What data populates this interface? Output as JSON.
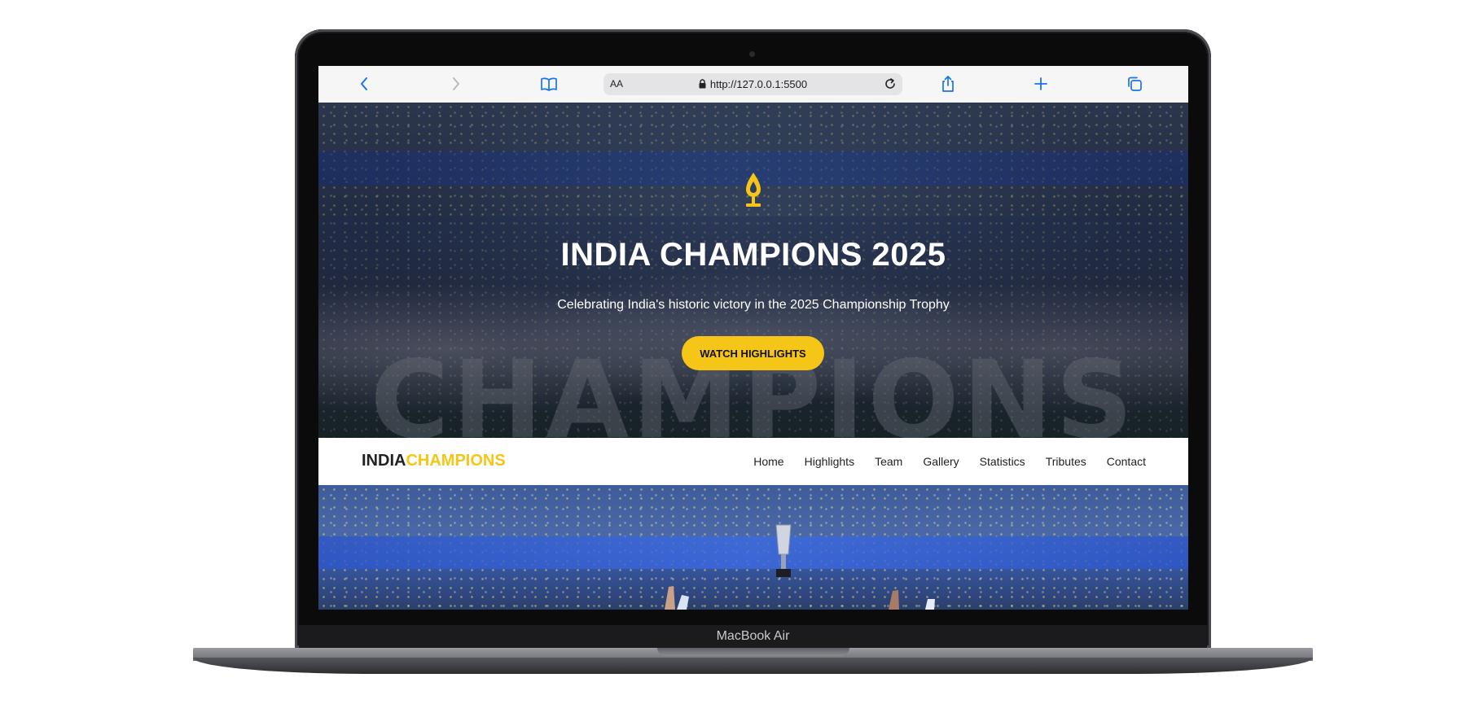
{
  "device": {
    "label": "MacBook Air"
  },
  "browser": {
    "text_size_label": "AA",
    "url": "http://127.0.0.1:5500",
    "icons": [
      "back-icon",
      "forward-icon",
      "bookmarks-icon",
      "lock-icon",
      "reload-icon",
      "share-icon",
      "new-tab-icon",
      "tabs-icon"
    ]
  },
  "hero": {
    "icon": "trophy-icon",
    "title": "INDIA CHAMPIONS 2025",
    "subtitle": "Celebrating India's historic victory in the 2025 Championship Trophy",
    "cta_label": "WATCH HIGHLIGHTS",
    "background_word": "CHAMPIONS",
    "accent_color": "#f5c518"
  },
  "navbar": {
    "logo_part1": "INDIA",
    "logo_part2": "CHAMPIONS",
    "links": [
      "Home",
      "Highlights",
      "Team",
      "Gallery",
      "Statistics",
      "Tributes",
      "Contact"
    ]
  }
}
